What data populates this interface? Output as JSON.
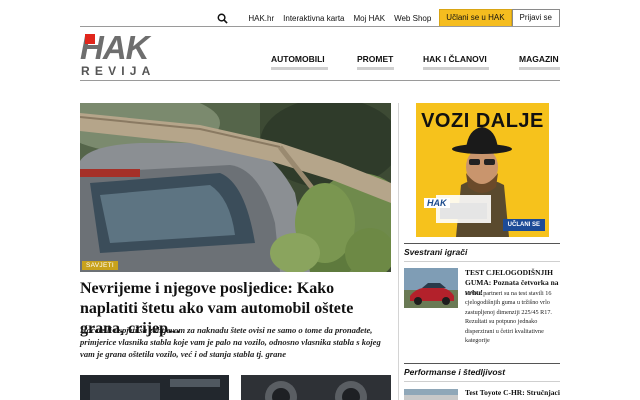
{
  "topbar": {
    "search_icon": "search-icon",
    "links": [
      "HAK.hr",
      "Interaktivna karta",
      "Moj HAK",
      "Web Shop"
    ],
    "join_label": "Učlani se u HAK",
    "login_label": "Prijavi se"
  },
  "logo": {
    "main": "HAK",
    "sub": "REVIJA"
  },
  "nav": [
    "AUTOMOBILI",
    "PROMET",
    "HAK I ČLANOVI",
    "MAGAZIN"
  ],
  "hero": {
    "tag": "SAVJETI",
    "headline": "Nevrijeme i njegove posljedice: Kako naplatiti štetu ako vam automobil oštete grana, crijep...",
    "lead": "Hoćete li uspjeti sa zahtjevom za naknadu štete ovisi ne samo o tome da pronađete, primjerice vlasnika stabla koje vam je palo na vozilo, odnosno vlasnika stabla s kojeg vam je grana oštetila vozilo, već i od stanja stabla tj. grane"
  },
  "ad": {
    "title": "VOZI DALJE",
    "brand": "HAK",
    "button": "UČLANI SE",
    "colors": {
      "background": "#f6c21c",
      "button": "#1c4b97"
    }
  },
  "sidebar": {
    "section1": {
      "title": "Svestrani igrači",
      "article_title": "TEST CJELOGODIŠNJIH GUMA: Poznata četvorka na vrhu!",
      "article_text": "HAK i partneri su na test stavili 16 cjelogodišnjih guma u tržišno vrlo zastupljenoj dimenziji 225/45 R17. Rezultati su potpuno jednako disperzirani u četiri kvalitativne kategorije"
    },
    "section2": {
      "title": "Performanse i štedljivost",
      "article_title": "Test Toyote C-HR: Stručnjaci za"
    }
  },
  "colors": {
    "accent": "#f5bd1f",
    "brand_red": "#e1261c",
    "tag": "#c8a21c"
  }
}
